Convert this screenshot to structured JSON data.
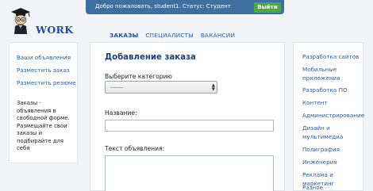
{
  "logo": {
    "text": "WORK",
    "mascot": "student-mascot-icon"
  },
  "welcome_bar": {
    "text": "Добро пожаловать, student1. Статус: Студент",
    "logout_label": "Выйти",
    "bg_color": "#3f6f9f",
    "logout_color": "#4caa45"
  },
  "nav": {
    "tabs": [
      {
        "label": "ЗАКАЗЫ",
        "active": true
      },
      {
        "label": "СПЕЦИАЛИСТЫ",
        "active": false
      },
      {
        "label": "ВАКАНСИИ",
        "active": false
      }
    ]
  },
  "left_sidebar": {
    "links": [
      "Ваши объявления",
      "Разместить заказ",
      "Разместить резюме"
    ],
    "note": "Заказы - объявления в свободной форме. Размещайте свои заказы и подбирайте для себя"
  },
  "form": {
    "title": "Добавление заказа",
    "category_label": "Выберите категорию",
    "category_selected": "-------",
    "name_label": "Название:",
    "name_value": "",
    "text_label": "Текст объявления:",
    "text_value": ""
  },
  "right_sidebar": {
    "categories": [
      "Разработка сайтов",
      "Мобильные приложения",
      "Разработка ПО",
      "Контент",
      "Администрирование",
      "Дизайн и мультимедиа",
      "Полиграфия",
      "Инженерия",
      "Реклама и маркетинг",
      "Разное"
    ]
  }
}
